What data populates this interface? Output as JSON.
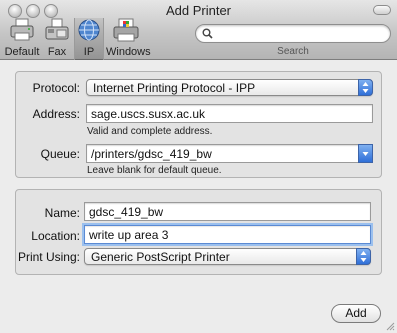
{
  "window": {
    "title": "Add Printer"
  },
  "toolbar": {
    "tools": [
      {
        "label": "Default",
        "icon": "printer-icon"
      },
      {
        "label": "Fax",
        "icon": "fax-icon"
      },
      {
        "label": "IP",
        "icon": "globe-icon",
        "selected": true
      },
      {
        "label": "Windows",
        "icon": "windows-printer-icon"
      }
    ],
    "search": {
      "value": "",
      "placeholder": "",
      "label": "Search"
    }
  },
  "connection": {
    "protocol": {
      "label": "Protocol:",
      "value": "Internet Printing Protocol - IPP"
    },
    "address": {
      "label": "Address:",
      "value": "sage.uscs.susx.ac.uk",
      "hint": "Valid and complete address."
    },
    "queue": {
      "label": "Queue:",
      "value": "/printers/gdsc_419_bw",
      "hint": "Leave blank for default queue."
    }
  },
  "details": {
    "name": {
      "label": "Name:",
      "value": "gdsc_419_bw"
    },
    "location": {
      "label": "Location:",
      "value": "write up area 3"
    },
    "print_using": {
      "label": "Print Using:",
      "value": "Generic PostScript Printer"
    }
  },
  "footer": {
    "add_label": "Add"
  },
  "colors": {
    "accent": "#2f6fd8",
    "focus_ring": "#9bc0ee"
  }
}
